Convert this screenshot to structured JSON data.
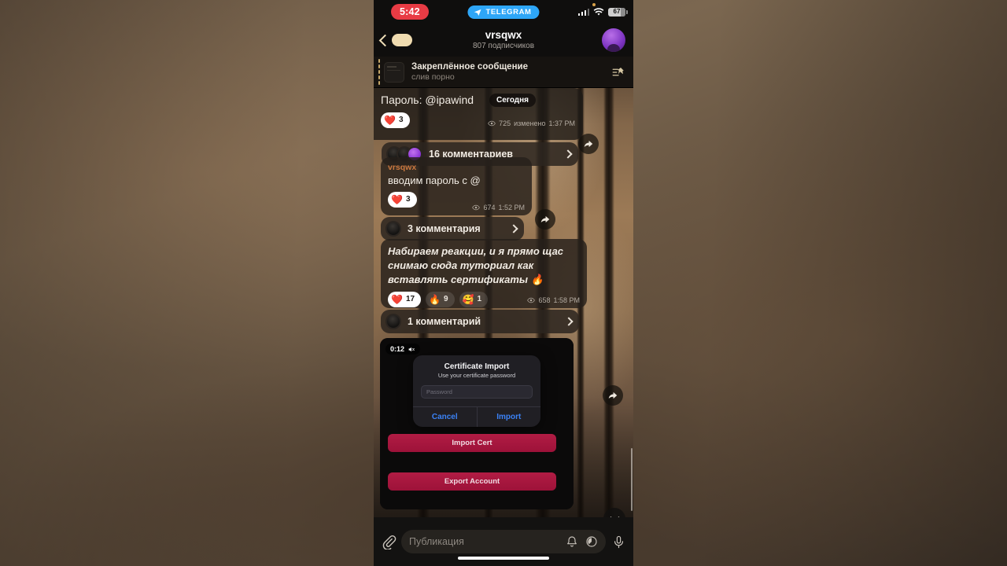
{
  "status_bar": {
    "time": "5:42",
    "recording_badge": "TELEGRAM",
    "battery_level": "67",
    "signal_icon": "cellular-signal-icon",
    "wifi_icon": "wifi-icon"
  },
  "chat_header": {
    "title": "vrsqwx",
    "subtitle": "807 подписчиков",
    "back_icon": "back-chevron-icon",
    "avatar_icon": "channel-avatar"
  },
  "pinned": {
    "title": "Закреплённое сообщение",
    "subtitle": "слив порно",
    "pin_icon": "pin-list-icon"
  },
  "date_separator": "Сегодня",
  "messages": [
    {
      "author": "",
      "text": "Пароль: @ipawind",
      "views": "725",
      "edited_label": "изменено",
      "time": "1:37 PM",
      "reactions": [
        {
          "emoji": "❤️",
          "count": "3",
          "style": "filled"
        }
      ],
      "comments_label": "16 комментариев",
      "avatars": [
        "dark",
        "dark",
        "purple"
      ]
    },
    {
      "author": "vrsqwx",
      "text": "вводим пароль с @",
      "views": "674",
      "edited_label": "",
      "time": "1:52 PM",
      "reactions": [
        {
          "emoji": "❤️",
          "count": "3",
          "style": "filled"
        }
      ],
      "comments_label": "3 комментария",
      "avatars": [
        "dark"
      ]
    },
    {
      "author": "",
      "text": "Набираем реакции, и я прямо щас снимаю сюда туториал как вставлять сертификаты 🔥",
      "views": "658",
      "edited_label": "",
      "time": "1:58 PM",
      "reactions": [
        {
          "emoji": "❤️",
          "count": "17",
          "style": "filled"
        },
        {
          "emoji": "🔥",
          "count": "9",
          "style": "hollow"
        },
        {
          "emoji": "🥰",
          "count": "1",
          "style": "hollow"
        }
      ],
      "comments_label": "1 комментарий",
      "avatars": [
        "dark"
      ]
    }
  ],
  "video_message": {
    "timer": "0:12",
    "mute_icon": "speaker-muted-icon",
    "dialog": {
      "title": "Certificate Import",
      "subtitle": "Use your certificate password",
      "password_placeholder": "Password",
      "password_value": "",
      "cancel_label": "Cancel",
      "confirm_label": "Import"
    },
    "buttons": [
      {
        "label": "Import Cert"
      },
      {
        "label": "Export Account"
      }
    ]
  },
  "scroll_down_icon": "chevron-down-icon",
  "composer": {
    "attach_icon": "paperclip-icon",
    "placeholder": "Публикация",
    "bell_icon": "bell-icon",
    "schedule_icon": "clock-icon",
    "mic_icon": "microphone-icon"
  },
  "colors": {
    "accent_blue": "#3b82f6",
    "telegram_blue": "#2ea6f7",
    "time_red": "#e83b44",
    "button_crimson": "#b11c44",
    "author_orange": "#c9773f"
  }
}
